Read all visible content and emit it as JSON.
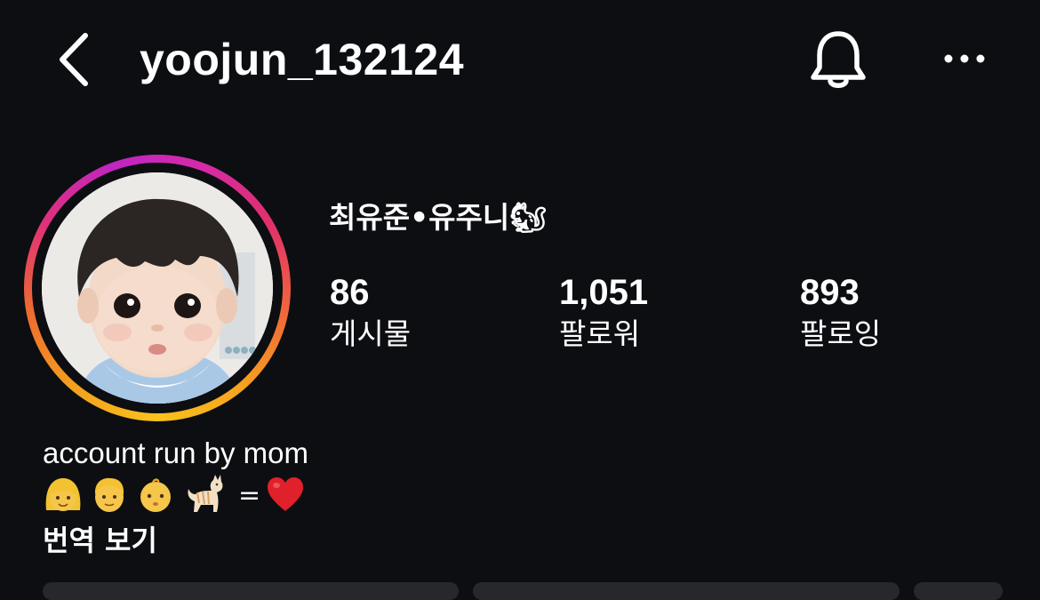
{
  "header": {
    "username": "yoojun_132124"
  },
  "profile": {
    "full_name": "최유준•유주니🐿",
    "stats": [
      {
        "value": "86",
        "label": "게시물"
      },
      {
        "value": "1,051",
        "label": "팔로워"
      },
      {
        "value": "893",
        "label": "팔로잉"
      }
    ],
    "bio_line1": "account run by mom",
    "bio_equals": "=",
    "translate_label": "번역 보기"
  },
  "colors": {
    "background": "#0c0e12",
    "text": "#ffffff",
    "heart": "#e0202a",
    "story_ring": [
      "#d62aa8",
      "#f7a31e",
      "#f9c21d"
    ]
  },
  "icons": [
    "back-chevron-icon",
    "bell-icon",
    "more-options-icon",
    "woman-emoji-icon",
    "man-emoji-icon",
    "baby-emoji-icon",
    "cat-emoji-icon",
    "red-heart-icon"
  ]
}
